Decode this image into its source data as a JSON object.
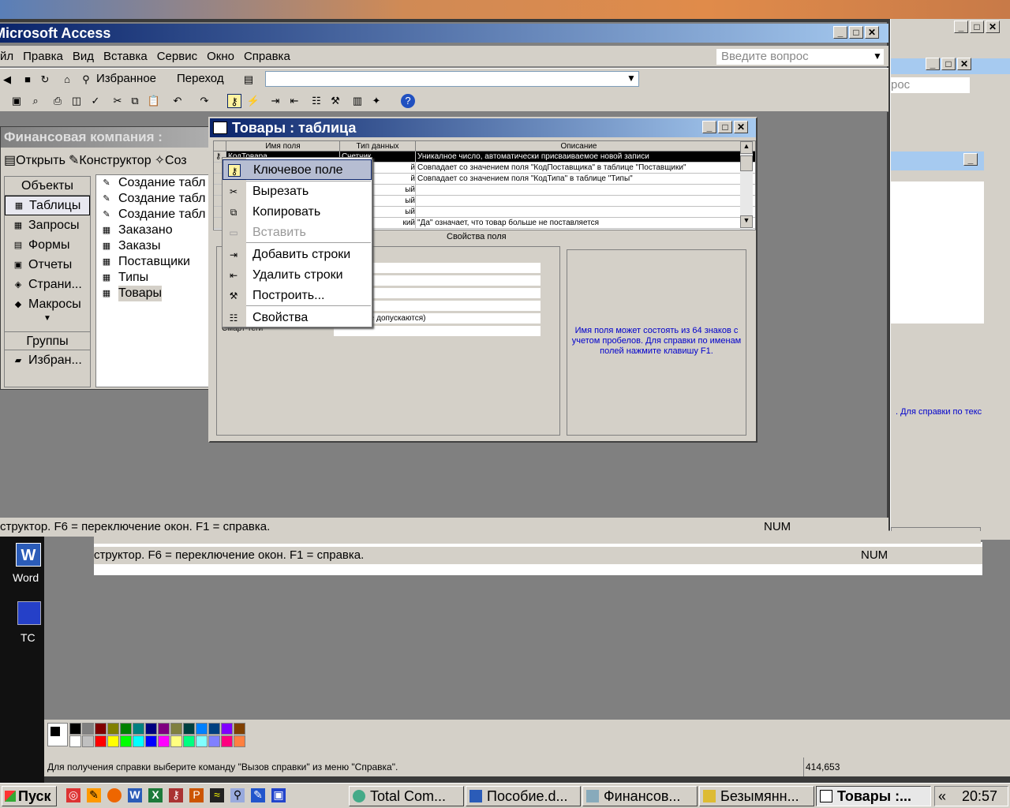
{
  "access": {
    "title": "Microsoft Access",
    "menu": [
      "Файл",
      "Правка",
      "Вид",
      "Вставка",
      "Сервис",
      "Окно",
      "Справка"
    ],
    "menu_visible": [
      "йл",
      "Правка",
      "Вид",
      "Вставка",
      "Сервис",
      "Окно",
      "Справка"
    ],
    "ask_placeholder": "Введите вопрос",
    "favorites": "Избранное",
    "go": "Переход",
    "status": "структор.  F6 = переключение окон.  F1 = справка.",
    "num": "NUM"
  },
  "dbwindow": {
    "title": "Финансовая  компания :",
    "open": "Открыть",
    "designer": "Конструктор",
    "create": "Соз",
    "objects_header": "Объекты",
    "objects": [
      {
        "label": "Таблицы",
        "icon": "table-icon"
      },
      {
        "label": "Запросы",
        "icon": "query-icon"
      },
      {
        "label": "Формы",
        "icon": "form-icon"
      },
      {
        "label": "Отчеты",
        "icon": "report-icon"
      },
      {
        "label": "Страни...",
        "icon": "page-icon"
      },
      {
        "label": "Макросы",
        "icon": "macro-icon"
      }
    ],
    "groups_header": "Группы",
    "groups": [
      {
        "label": "Избран...",
        "icon": "folder-icon"
      }
    ],
    "list": [
      "Создание табл",
      "Создание табл",
      "Создание табл",
      "Заказано",
      "Заказы",
      "Поставщики",
      "Типы",
      "Товары"
    ]
  },
  "tablewin": {
    "title": "Товары : таблица",
    "headers": [
      "Имя поля",
      "Тип данных",
      "Описание"
    ],
    "rows": [
      {
        "name": "КодТовара",
        "type": "Счетчик",
        "desc": "Уникалное число, автоматически присваиваемое новой записи"
      },
      {
        "name": "",
        "type": "й",
        "desc": "Совпадает со значением поля \"КодПоставщика\" в таблице \"Поставщики\""
      },
      {
        "name": "",
        "type": "й",
        "desc": "Совпадает со значением поля \"КодТипа\" в таблице \"Типы\""
      },
      {
        "name": "",
        "type": "ый",
        "desc": ""
      },
      {
        "name": "",
        "type": "ый",
        "desc": ""
      },
      {
        "name": "",
        "type": "ый",
        "desc": ""
      },
      {
        "name": "",
        "type": "кий",
        "desc": "\"Да\" означает, что товар больше не поставляется"
      }
    ],
    "props_label": "Свойства поля",
    "props": [
      {
        "label": "",
        "value": "целое"
      },
      {
        "label": "",
        "value": "ательные"
      },
      {
        "label": "",
        "value": ""
      },
      {
        "label": "",
        "value": ""
      },
      {
        "label": "",
        "value": "адения не допускаются)"
      },
      {
        "label": "Смарт-теги",
        "value": ""
      }
    ],
    "help": "Имя поля может состоять из 64 знаков с учетом пробелов.  Для справки по именам полей нажмите клавишу F1."
  },
  "context_menu": [
    {
      "label": "Ключевое поле",
      "icon": "key-icon",
      "state": "highlight"
    },
    {
      "label": "Вырезать",
      "icon": "scissors-icon",
      "state": "normal"
    },
    {
      "label": "Копировать",
      "icon": "copy-icon",
      "state": "normal"
    },
    {
      "label": "Вставить",
      "icon": "paste-icon",
      "state": "disabled"
    },
    {
      "label": "Добавить строки",
      "icon": "insert-rows-icon",
      "state": "normal"
    },
    {
      "label": "Удалить строки",
      "icon": "delete-rows-icon",
      "state": "normal"
    },
    {
      "label": "Построить...",
      "icon": "build-icon",
      "state": "normal"
    },
    {
      "label": "Свойства",
      "icon": "properties-icon",
      "state": "normal"
    }
  ],
  "background_window": {
    "ask_fragment": "рос",
    "help_fragment": ".  Для справки по текс",
    "status": "структор.  F6 = переключение окон.  F1 = справка.",
    "num": "NUM"
  },
  "desktop_icons": [
    {
      "label": "Word"
    },
    {
      "label": "TC"
    }
  ],
  "paint": {
    "status": "Для получения справки выберите команду \"Вызов справки\" из меню \"Справка\".",
    "coords": "414,653",
    "colors_top": [
      "#000000",
      "#808080",
      "#800000",
      "#808000",
      "#008000",
      "#008080",
      "#000080",
      "#800080",
      "#808040",
      "#004040",
      "#0080ff",
      "#004080",
      "#8000ff",
      "#804000"
    ],
    "colors_bottom": [
      "#ffffff",
      "#c0c0c0",
      "#ff0000",
      "#ffff00",
      "#00ff00",
      "#00ffff",
      "#0000ff",
      "#ff00ff",
      "#ffff80",
      "#00ff80",
      "#80ffff",
      "#8080ff",
      "#ff0080",
      "#ff8040"
    ]
  },
  "taskbar": {
    "start": "Пуск",
    "tasks": [
      "Total Com...",
      "Пособие.d...",
      "Финансов...",
      "Безымянн...",
      "Товары :..."
    ],
    "chevron": "«",
    "clock": "20:57"
  }
}
